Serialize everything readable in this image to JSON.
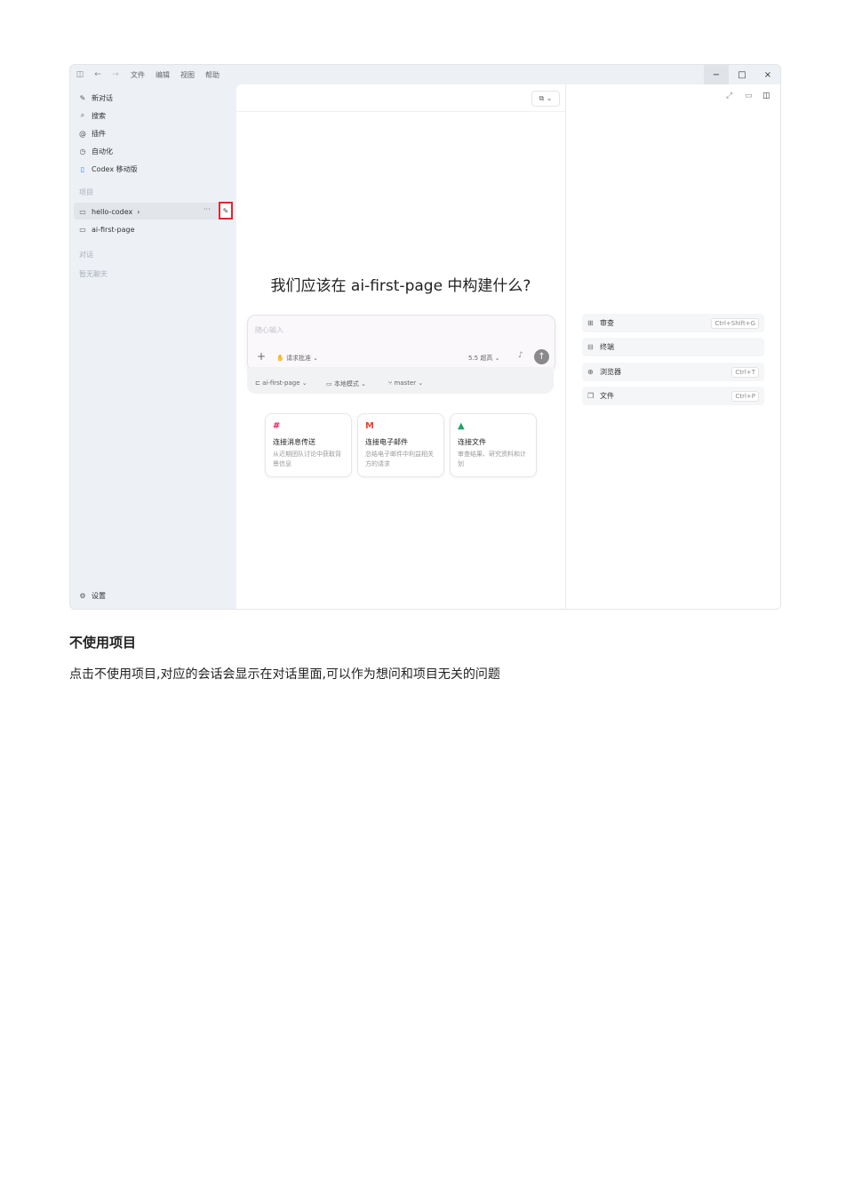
{
  "window": {
    "menu": [
      "文件",
      "编辑",
      "视图",
      "帮助"
    ],
    "controls": {
      "minimize": "−",
      "maximize": "□",
      "close": "×"
    }
  },
  "sidebar": {
    "items": [
      {
        "icon": "new-chat-icon",
        "glyph": "✎",
        "label": "新对话"
      },
      {
        "icon": "search-icon",
        "glyph": "⌕",
        "label": "搜索"
      },
      {
        "icon": "plugin-icon",
        "glyph": "@",
        "label": "插件"
      },
      {
        "icon": "clock-icon",
        "glyph": "◷",
        "label": "自动化"
      },
      {
        "icon": "mobile-icon",
        "glyph": "▯",
        "label": "Codex 移动版"
      }
    ],
    "projects_heading": "项目",
    "projects": [
      {
        "label": "hello-codex",
        "chevron": "›",
        "active": true
      },
      {
        "label": "ai-first-page",
        "active": false
      }
    ],
    "project_more": "···",
    "project_edit_glyph": "✎",
    "chats_heading": "对话",
    "chats_empty": "暂无聊天",
    "settings_label": "设置",
    "settings_glyph": "⚙"
  },
  "main": {
    "toolbar_glyph": "⧉ ⌄",
    "headline": "我们应该在 ai-first-page 中构建什么?",
    "composer": {
      "placeholder": "随心输入",
      "plus": "+",
      "approval": "请求批准 ⌄",
      "model": "5.5 超高 ⌄",
      "mic": "♪",
      "send": "↑"
    },
    "context": {
      "project": "ai-first-page ⌄",
      "mode": "本地模式 ⌄",
      "branch": "master ⌄"
    },
    "cards": [
      {
        "icon": "slack-icon",
        "glyph": "#",
        "color": "#e01e5a",
        "title": "连接消息传送",
        "desc": "从近期团队讨论中获取背景信息"
      },
      {
        "icon": "gmail-icon",
        "glyph": "M",
        "color": "#ea4335",
        "title": "连接电子邮件",
        "desc": "总结电子邮件中利益相关方的请求"
      },
      {
        "icon": "drive-icon",
        "glyph": "▲",
        "color": "#1fa463",
        "title": "连接文件",
        "desc": "审查结果、研究资料和计划"
      }
    ]
  },
  "right_panel": {
    "top_icons": [
      "⤢",
      "▭",
      "◫"
    ],
    "items": [
      {
        "icon": "review-icon",
        "glyph": "⊞",
        "label": "审查",
        "shortcut": "Ctrl+Shift+G"
      },
      {
        "icon": "terminal-icon",
        "glyph": "⊟",
        "label": "终端",
        "shortcut": ""
      },
      {
        "icon": "globe-icon",
        "glyph": "⊕",
        "label": "浏览器",
        "shortcut": "Ctrl+T"
      },
      {
        "icon": "files-icon",
        "glyph": "❐",
        "label": "文件",
        "shortcut": "Ctrl+P"
      }
    ]
  },
  "document": {
    "heading": "不使用项目",
    "paragraph": "点击不使用项目,对应的会话会显示在对话里面,可以作为想问和项目无关的问题"
  }
}
